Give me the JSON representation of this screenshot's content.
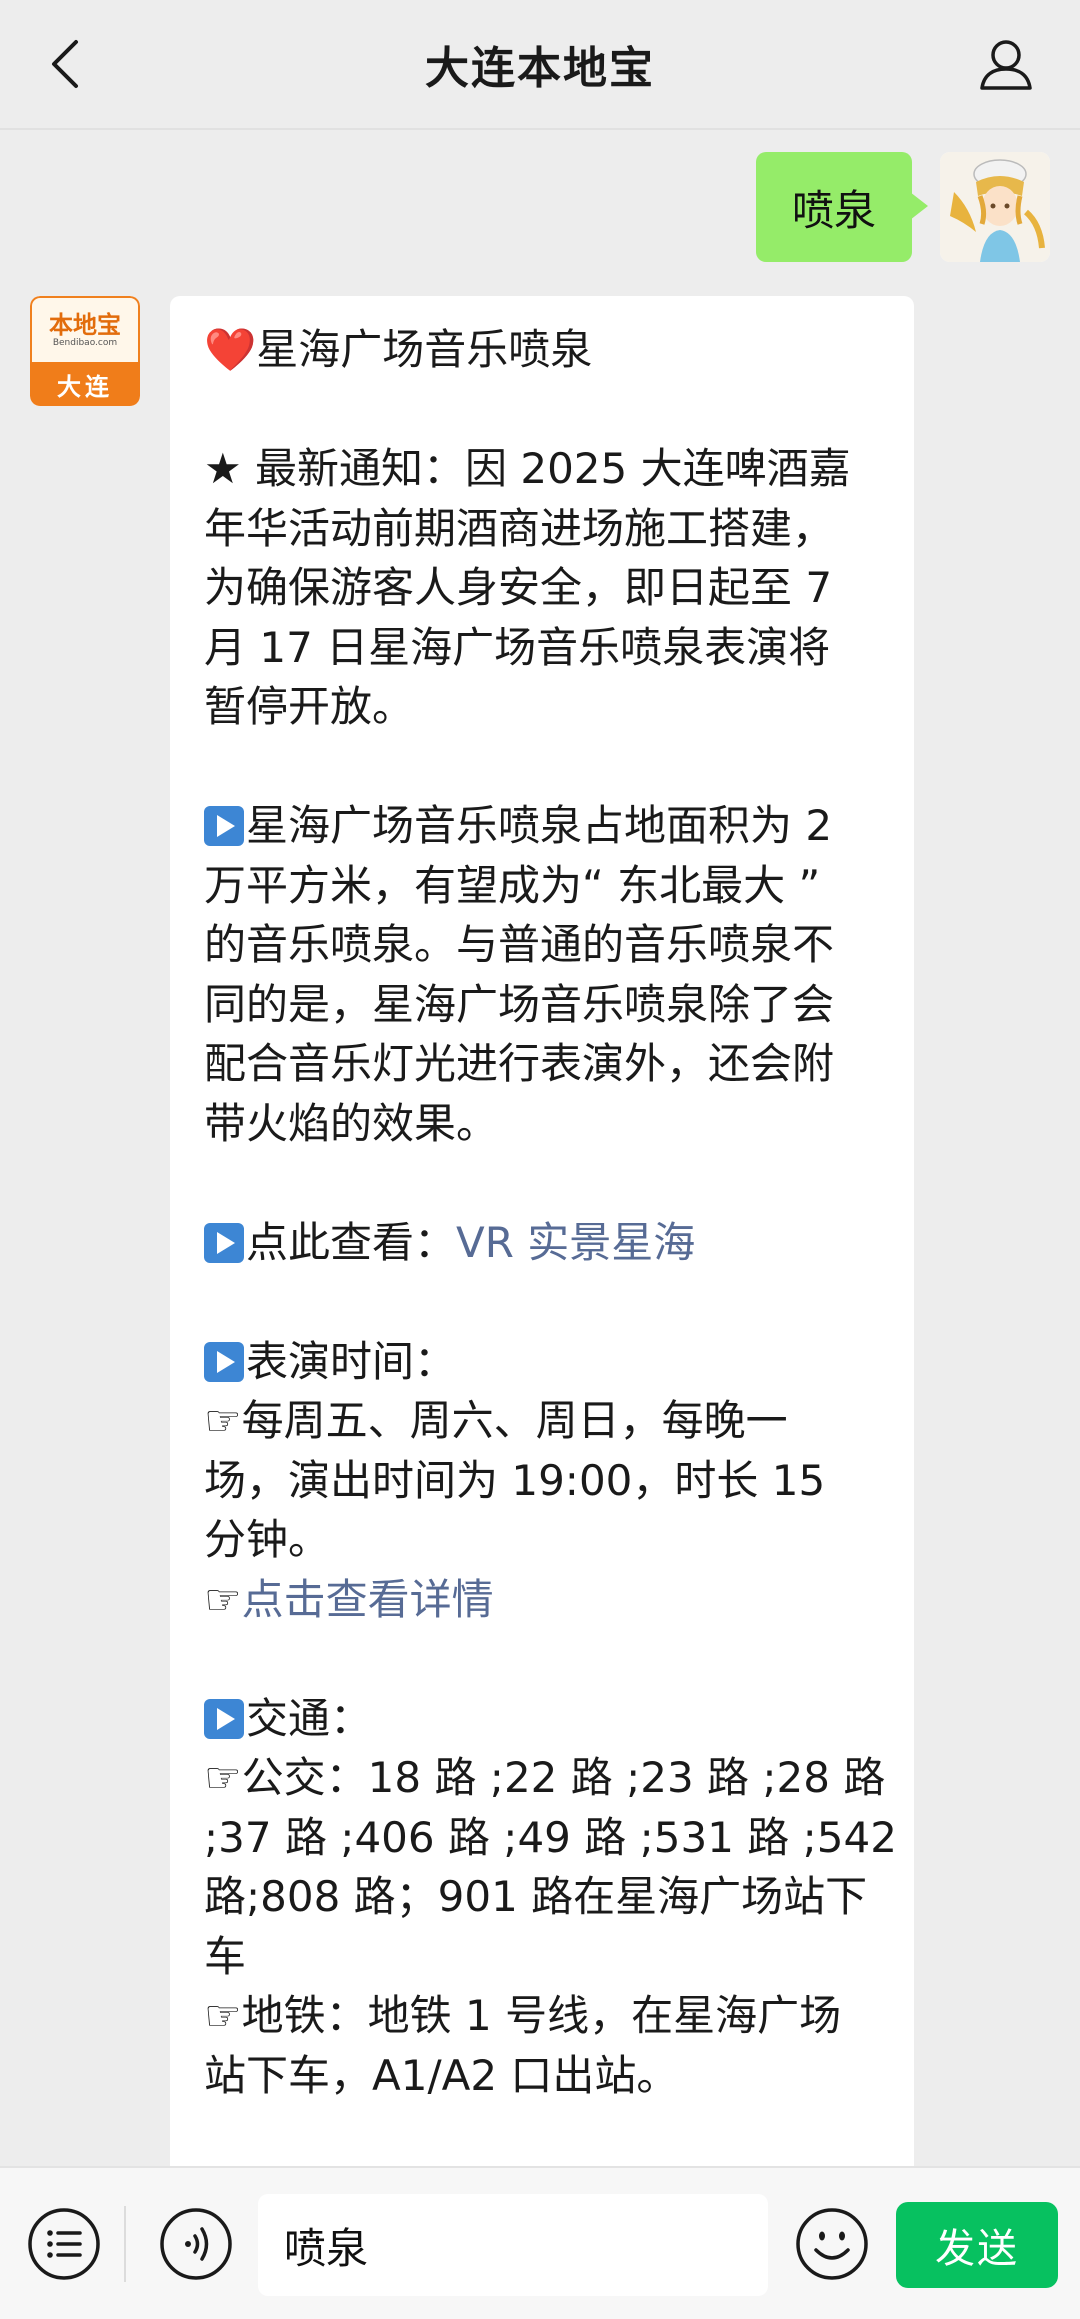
{
  "header": {
    "title": "大连本地宝",
    "back_icon": "chevron-left-icon",
    "profile_icon": "person-icon"
  },
  "outgoing_message": {
    "text": "喷泉",
    "bubble_color": "#95ec69"
  },
  "bot": {
    "avatar_brand": "本地宝",
    "avatar_sub": "Bendibao.com",
    "avatar_city": "大连",
    "brand_color": "#f07d1a"
  },
  "reply": {
    "l01": "星海广场音乐喷泉",
    "l02": "★ 最新通知：因 2025 大连啤酒嘉",
    "l03": "年华活动前期酒商进场施工搭建，",
    "l04": "为确保游客人身安全，即日起至 7",
    "l05": "月 17 日星海广场音乐喷泉表演将",
    "l06": "暂停开放。",
    "l07": "星海广场音乐喷泉占地面积为 2",
    "l08": "万平方米，有望成为“ 东北最大 ”",
    "l09": "的音乐喷泉。与普通的音乐喷泉不",
    "l10": "同的是，星海广场音乐喷泉除了会",
    "l11": "配合音乐灯光进行表演外，还会附",
    "l12": "带火焰的效果。",
    "l13_prefix": "点此查看：",
    "l13_link": "VR 实景星海",
    "l14": "表演时间：",
    "l15": "每周五、周六、周日，每晚一",
    "l16": "场，演出时间为 19:00，时长 15",
    "l17": "分钟。",
    "l18_link": "点击查看详情",
    "l19": "交通：",
    "l20": "公交：18 路 ;22 路 ;23 路 ;28 路",
    "l21": ";37 路 ;406 路 ;49 路 ;531 路 ;542",
    "l22": "路;808 路；901 路在星海广场站下",
    "l23": "车",
    "l24": "地铁：地铁 1 号线，在星海广场",
    "l25": "站下车，A1/A2 口出站。",
    "heart_glyph": "❤️",
    "hand_glyph": "☞",
    "link_color": "#576b95"
  },
  "inputbar": {
    "menu_icon": "list-icon",
    "voice_icon": "voice-icon",
    "input_value": "喷泉",
    "emoji_icon": "smiley-icon",
    "send_label": "发送",
    "send_color": "#07c160"
  }
}
